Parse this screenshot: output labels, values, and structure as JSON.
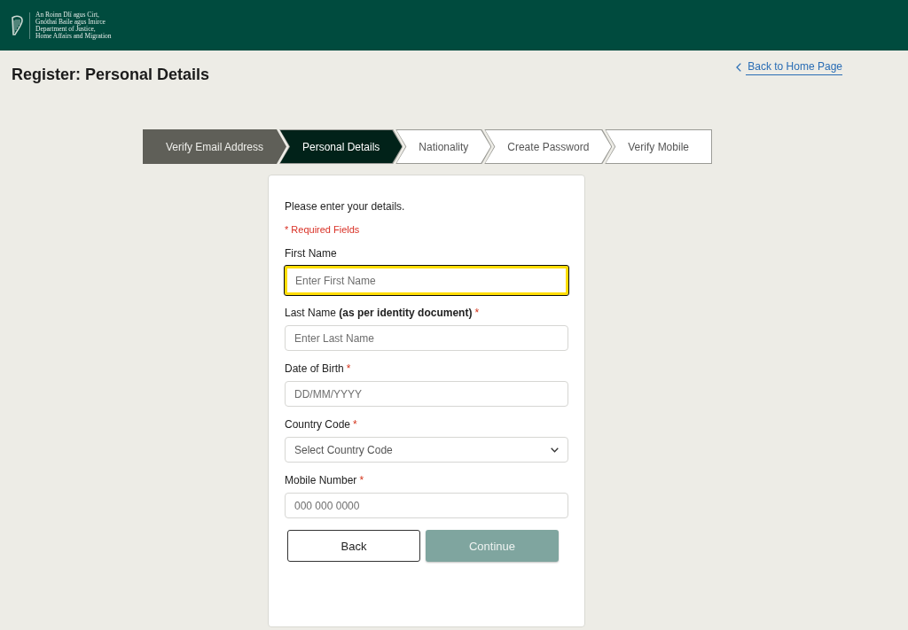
{
  "header": {
    "logo_lines": [
      "An Roinn Dlí agus Cirt,",
      "Gnóthaí Baile agus Imirce",
      "Department of Justice,",
      "Home Affairs and Migration"
    ]
  },
  "page": {
    "title": "Register: Personal Details",
    "back_link": "Back to Home Page"
  },
  "steps": [
    {
      "label": "Verify Email Address",
      "completed": true,
      "selected": false
    },
    {
      "label": "Personal Details",
      "completed": false,
      "selected": true
    },
    {
      "label": "Nationality",
      "completed": false,
      "selected": false
    },
    {
      "label": "Create Password",
      "completed": false,
      "selected": false
    },
    {
      "label": "Verify Mobile",
      "completed": false,
      "selected": false
    }
  ],
  "form": {
    "intro": "Please enter your details.",
    "required_note": "* Required Fields",
    "fields": [
      {
        "kind": "text",
        "label": "First Name",
        "placeholder": "Enter First Name",
        "focused": true
      },
      {
        "kind": "text",
        "label": "Last Name **(as per identity document)**",
        "required_mark": "*",
        "placeholder": "Enter Last Name",
        "focused": false
      },
      {
        "kind": "text",
        "label": "Date of Birth",
        "required_mark": "*",
        "placeholder": "DD/MM/YYYY",
        "focused": false
      },
      {
        "kind": "select",
        "label": "Country Code",
        "required_mark": "*",
        "placeholder": "Select Country Code",
        "focused": false
      },
      {
        "kind": "text",
        "label": "Mobile Number",
        "required_mark": "*",
        "placeholder": "000 000 0000",
        "focused": false
      }
    ],
    "buttons": [
      {
        "label": "Back",
        "kind": "secondary",
        "disabled": false
      },
      {
        "label": "Continue",
        "kind": "primary",
        "disabled": true
      }
    ]
  }
}
